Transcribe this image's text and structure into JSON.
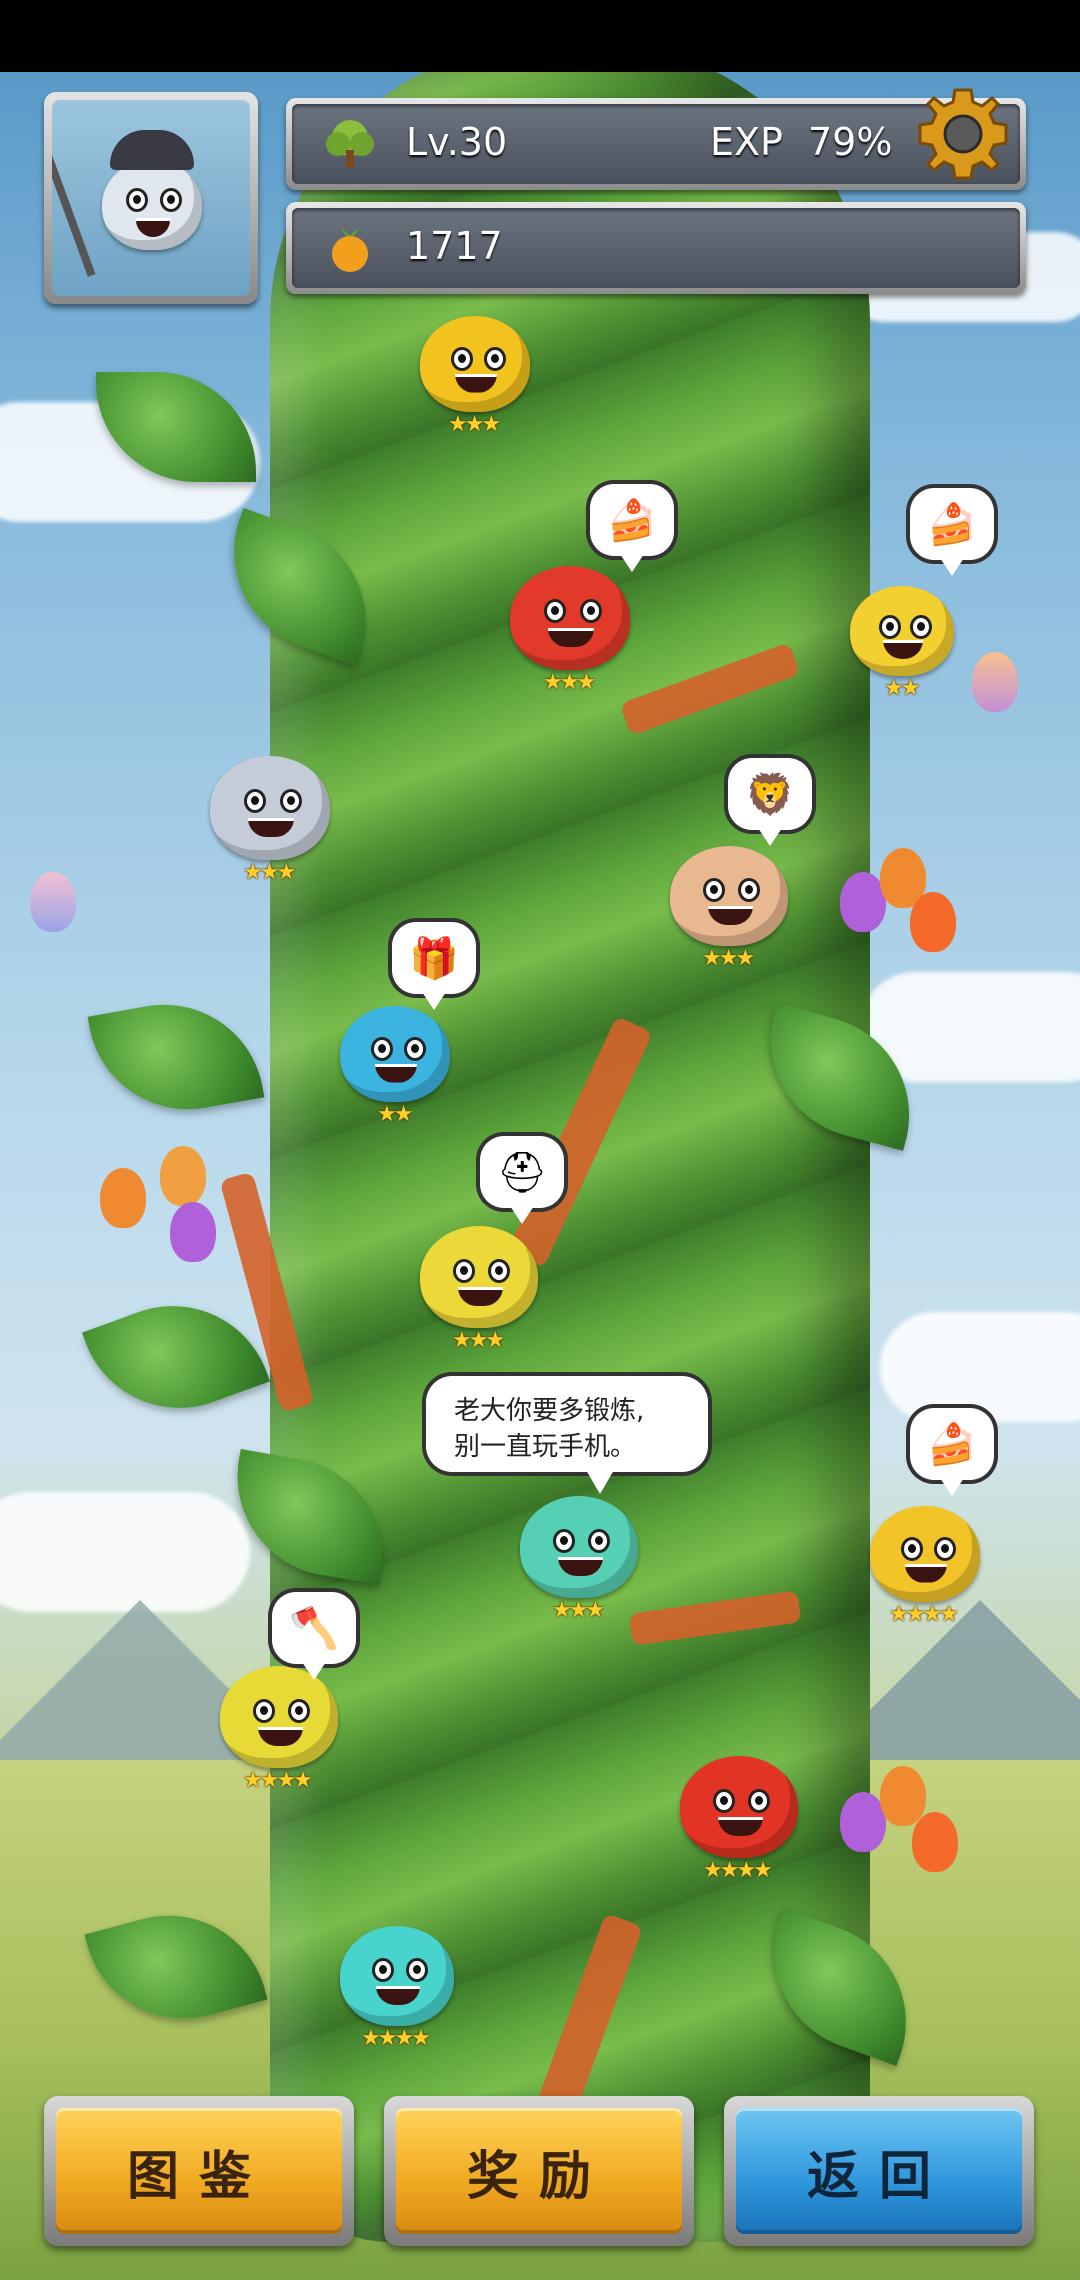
{
  "hud": {
    "level": "Lv.30",
    "exp_label": "EXP",
    "exp_percent": "79%",
    "resource_count": "1717",
    "settings_icon": "gear-icon",
    "level_icon": "tree-icon",
    "resource_icon": "fruit-icon"
  },
  "characters": [
    {
      "name": "yellow-monkey-king",
      "color": "#f2c21e",
      "stars": "★★★",
      "bubble": null
    },
    {
      "name": "red-fire-warrior",
      "color": "#e23a2a",
      "stars": "★★★",
      "bubble": "cake-icon"
    },
    {
      "name": "yellow-pirate-captain",
      "color": "#f2d030",
      "stars": "★★",
      "bubble": "cake-icon"
    },
    {
      "name": "grey-ice-reaper",
      "color": "#c4ccd8",
      "stars": "★★★",
      "bubble": null
    },
    {
      "name": "tan-lion-dancer",
      "color": "#e8b890",
      "stars": "★★★",
      "bubble": "lion-icon"
    },
    {
      "name": "blue-pirate",
      "color": "#3cb4e0",
      "stars": "★★",
      "bubble": "gift-icon"
    },
    {
      "name": "yellow-dark-knight",
      "color": "#ecd838",
      "stars": "★★★",
      "bubble": "helmet-icon"
    },
    {
      "name": "teal-wizard",
      "color": "#56d0b4",
      "stars": "★★★",
      "bubble": null
    },
    {
      "name": "yellow-spartan",
      "color": "#f2c428",
      "stars": "★★★★",
      "bubble": "cake-icon"
    },
    {
      "name": "yellow-forest-axe",
      "color": "#e8da36",
      "stars": "★★★★",
      "bubble": "axe-icon"
    },
    {
      "name": "red-knight",
      "color": "#e23424",
      "stars": "★★★★",
      "bubble": null
    },
    {
      "name": "teal-barbarian",
      "color": "#48d4cc",
      "stars": "★★★★",
      "bubble": null
    }
  ],
  "speech": {
    "line1": "老大你要多锻炼,",
    "line2": "别一直玩手机。"
  },
  "buttons": {
    "codex": "图鉴",
    "reward": "奖励",
    "back": "返回"
  }
}
